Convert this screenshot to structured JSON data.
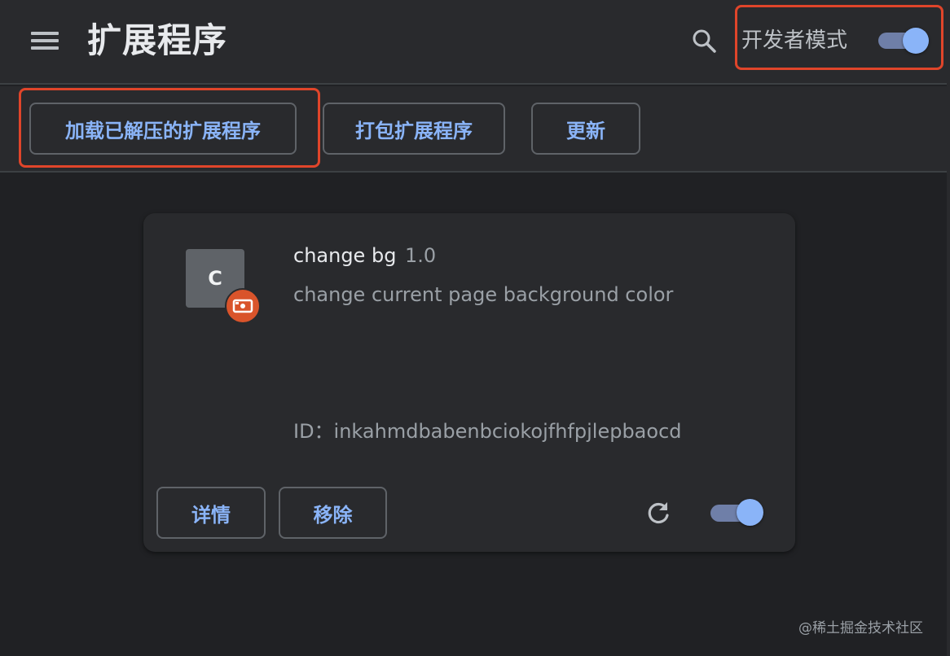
{
  "header": {
    "title": "扩展程序",
    "dev_mode_label": "开发者模式",
    "dev_mode_enabled": true
  },
  "toolbar": {
    "load_unpacked": "加载已解压的扩展程序",
    "pack_extension": "打包扩展程序",
    "update": "更新"
  },
  "extension": {
    "icon_letter": "C",
    "name": "change bg",
    "version": "1.0",
    "description": "change current page background color",
    "id_text": "ID：inkahmdbabenbciokojfhfpjlepbaocd",
    "details_label": "详情",
    "remove_label": "移除",
    "enabled": true
  },
  "watermark": "@稀土掘金技术社区",
  "colors": {
    "accent": "#8ab4f8",
    "highlight": "#e0452a",
    "background": "#202124",
    "surface": "#292a2d"
  }
}
